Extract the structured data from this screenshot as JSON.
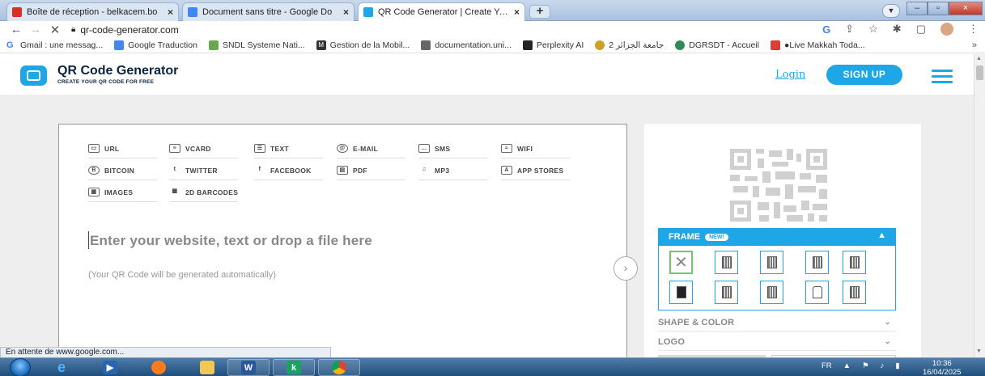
{
  "browser": {
    "tabs": [
      {
        "title": "Boîte de réception - belkacem.bo",
        "close": "×",
        "favicon_color": "#d93025"
      },
      {
        "title": "Document sans titre - Google Do",
        "close": "×",
        "favicon_color": "#4285f4"
      },
      {
        "title": "QR Code Generator | Create Your",
        "close": "×",
        "favicon_color": "#1ea6e6"
      }
    ],
    "new_tab": "+",
    "address": "qr-code-generator.com",
    "window_controls": [
      "–",
      "▫",
      "×"
    ],
    "status_text": "En attente de www.google.com..."
  },
  "bookmarks": [
    {
      "label": "Gmail : une messag...",
      "color": "#4285f4",
      "icon": "G"
    },
    {
      "label": "Google Traduction",
      "color": "#4285f4",
      "icon": ""
    },
    {
      "label": "SNDL Systeme Nati...",
      "color": "#6aa84f",
      "icon": ""
    },
    {
      "label": "Gestion de la Mobil...",
      "color": "#333333",
      "icon": "M"
    },
    {
      "label": "documentation.uni...",
      "color": "#666666",
      "icon": ""
    },
    {
      "label": "Perplexity AI",
      "color": "#222222",
      "icon": ""
    },
    {
      "label": "جامعة الجزائر 2",
      "color": "#c9a227",
      "icon": ""
    },
    {
      "label": "DGRSDT - Accueil",
      "color": "#2e8b57",
      "icon": ""
    },
    {
      "label": "●Live Makkah Toda...",
      "color": "#e53935",
      "icon": ""
    }
  ],
  "bookmarks_more": "»",
  "site": {
    "brand_title": "QR Code Generator",
    "brand_subtitle": "CREATE YOUR QR CODE FOR FREE",
    "login": "Login",
    "signup": "SIGN UP",
    "accent": "#1ea6e6"
  },
  "qr_types": [
    {
      "label": "URL",
      "icon": "url-icon",
      "glyph": "▭"
    },
    {
      "label": "VCARD",
      "icon": "vcard-icon",
      "glyph": "≡"
    },
    {
      "label": "TEXT",
      "icon": "text-icon",
      "glyph": "☰"
    },
    {
      "label": "E-MAIL",
      "icon": "email-icon",
      "glyph": "@"
    },
    {
      "label": "SMS",
      "icon": "sms-icon",
      "glyph": "…"
    },
    {
      "label": "WIFI",
      "icon": "wifi-icon",
      "glyph": "≈"
    },
    {
      "label": "BITCOIN",
      "icon": "bitcoin-icon",
      "glyph": "B"
    },
    {
      "label": "TWITTER",
      "icon": "twitter-icon",
      "glyph": "t"
    },
    {
      "label": "FACEBOOK",
      "icon": "facebook-icon",
      "glyph": "f"
    },
    {
      "label": "PDF",
      "icon": "pdf-icon",
      "glyph": "▤"
    },
    {
      "label": "MP3",
      "icon": "mp3-icon",
      "glyph": "♫"
    },
    {
      "label": "APP STORES",
      "icon": "app-stores-icon",
      "glyph": "A"
    },
    {
      "label": "IMAGES",
      "icon": "images-icon",
      "glyph": "▦"
    },
    {
      "label": "2D BARCODES",
      "icon": "barcodes-icon",
      "glyph": "▩"
    }
  ],
  "input": {
    "placeholder": "Enter your website, text or drop a file here",
    "note": "(Your QR Code will be generated automatically)"
  },
  "side": {
    "frame_label": "FRAME",
    "frame_badge": "NEW!",
    "shape_label": "SHAPE & COLOR",
    "logo_label": "LOGO"
  },
  "taskbar": {
    "lang": "FR",
    "time": "10:36",
    "date": "16/04/2025"
  }
}
